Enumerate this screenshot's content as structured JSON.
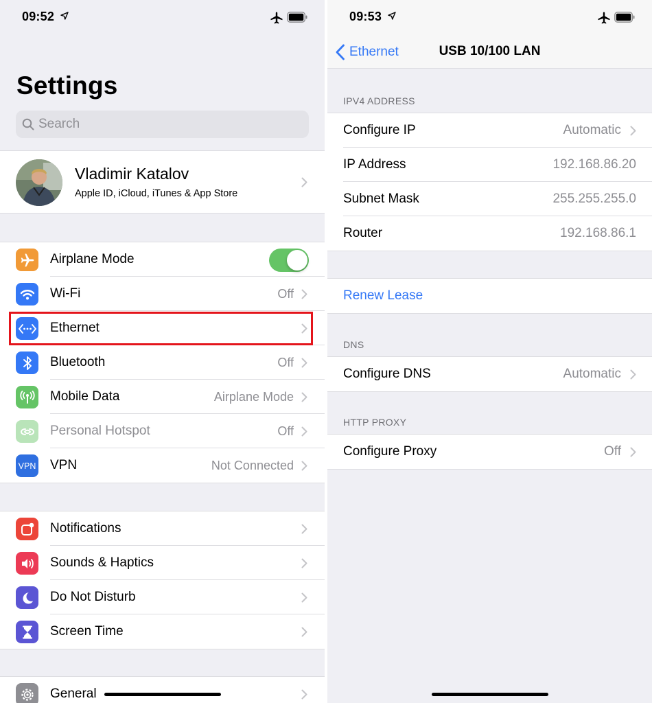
{
  "left": {
    "status": {
      "time": "09:52"
    },
    "title": "Settings",
    "search": {
      "placeholder": "Search"
    },
    "profile": {
      "name": "Vladimir Katalov",
      "subtitle": "Apple ID, iCloud, iTunes & App Store"
    },
    "connectivity": [
      {
        "label": "Airplane Mode",
        "value": "",
        "icon": "airplane-icon",
        "color": "#f19a37",
        "toggle_on": true
      },
      {
        "label": "Wi-Fi",
        "value": "Off",
        "icon": "wifi-icon",
        "color": "#3478f6"
      },
      {
        "label": "Ethernet",
        "value": "",
        "icon": "ethernet-icon",
        "color": "#3478f6",
        "highlighted": true
      },
      {
        "label": "Bluetooth",
        "value": "Off",
        "icon": "bluetooth-icon",
        "color": "#3478f6"
      },
      {
        "label": "Mobile Data",
        "value": "Airplane Mode",
        "icon": "antenna-icon",
        "color": "#65c466"
      },
      {
        "label": "Personal Hotspot",
        "value": "Off",
        "icon": "hotspot-icon",
        "color": "#65c466",
        "disabled": true
      },
      {
        "label": "VPN",
        "value": "Not Connected",
        "icon": "vpn-icon",
        "color": "#2f6fe0",
        "icon_text": "VPN"
      }
    ],
    "notifications": [
      {
        "label": "Notifications",
        "icon": "notifications-icon",
        "color": "#ec4539"
      },
      {
        "label": "Sounds & Haptics",
        "icon": "sound-icon",
        "color": "#ec3a55"
      },
      {
        "label": "Do Not Disturb",
        "icon": "moon-icon",
        "color": "#5b55d4"
      },
      {
        "label": "Screen Time",
        "icon": "hourglass-icon",
        "color": "#5b55d4"
      }
    ],
    "general": [
      {
        "label": "General",
        "icon": "gear-icon",
        "color": "#8e8e93"
      }
    ]
  },
  "right": {
    "status": {
      "time": "09:53"
    },
    "nav": {
      "back_label": "Ethernet",
      "title": "USB 10/100 LAN"
    },
    "ipv4": {
      "header": "IPV4 ADDRESS",
      "rows": [
        {
          "label": "Configure IP",
          "value": "Automatic",
          "chevron": true
        },
        {
          "label": "IP Address",
          "value": "192.168.86.20",
          "chevron": false
        },
        {
          "label": "Subnet Mask",
          "value": "255.255.255.0",
          "chevron": false
        },
        {
          "label": "Router",
          "value": "192.168.86.1",
          "chevron": false
        }
      ]
    },
    "renew": "Renew Lease",
    "dns": {
      "header": "DNS",
      "rows": [
        {
          "label": "Configure DNS",
          "value": "Automatic",
          "chevron": true
        }
      ]
    },
    "proxy": {
      "header": "HTTP PROXY",
      "rows": [
        {
          "label": "Configure Proxy",
          "value": "Off",
          "chevron": true
        }
      ]
    }
  },
  "colors": {
    "accent": "#3478f6",
    "highlight": "#e4141b",
    "toggle_on": "#65c466"
  }
}
